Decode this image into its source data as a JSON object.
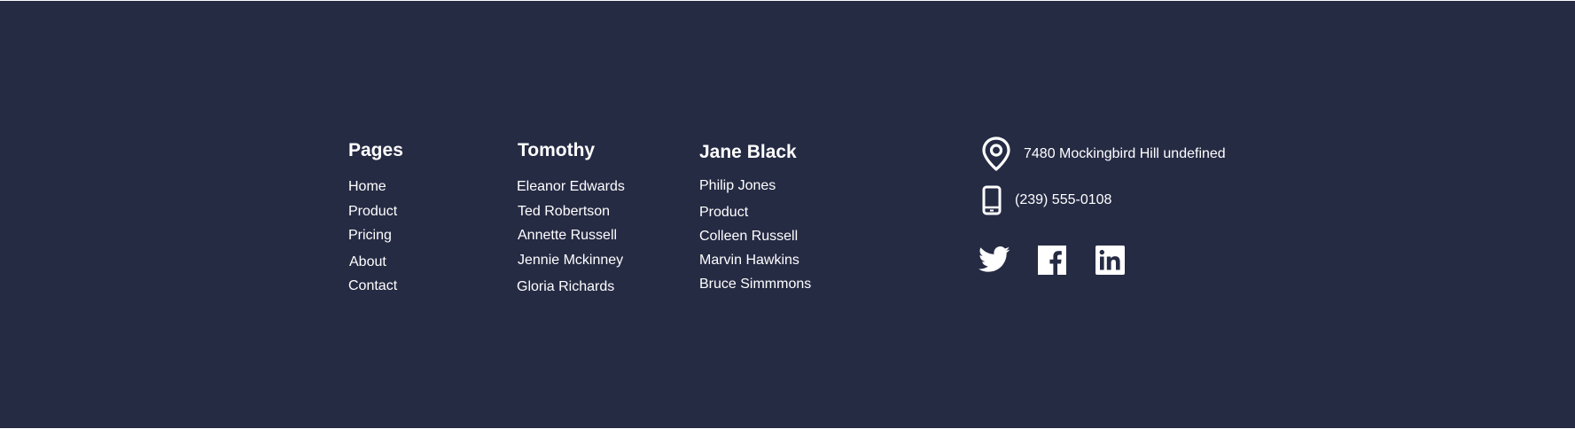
{
  "footer": {
    "columns": [
      {
        "title": "Pages",
        "links": [
          "Home",
          "Product",
          "Pricing",
          "About",
          "Contact"
        ]
      },
      {
        "title": "Tomothy",
        "links": [
          "Eleanor Edwards",
          "Ted Robertson",
          "Annette Russell",
          "Jennie Mckinney",
          "Gloria Richards"
        ]
      },
      {
        "title": "Jane Black",
        "links": [
          "Philip Jones",
          "Product",
          "Colleen Russell",
          "Marvin Hawkins",
          "Bruce Simmmons"
        ]
      }
    ],
    "contact": {
      "address": "7480 Mockingbird Hill undefined",
      "address_icon": "location-pin-icon",
      "phone": "(239) 555-0108",
      "phone_icon": "phone-icon"
    },
    "social": [
      {
        "name": "twitter-icon"
      },
      {
        "name": "facebook-icon"
      },
      {
        "name": "linkedin-icon"
      }
    ],
    "colors": {
      "background": "#262B44",
      "text": "#FFFFFF"
    }
  }
}
